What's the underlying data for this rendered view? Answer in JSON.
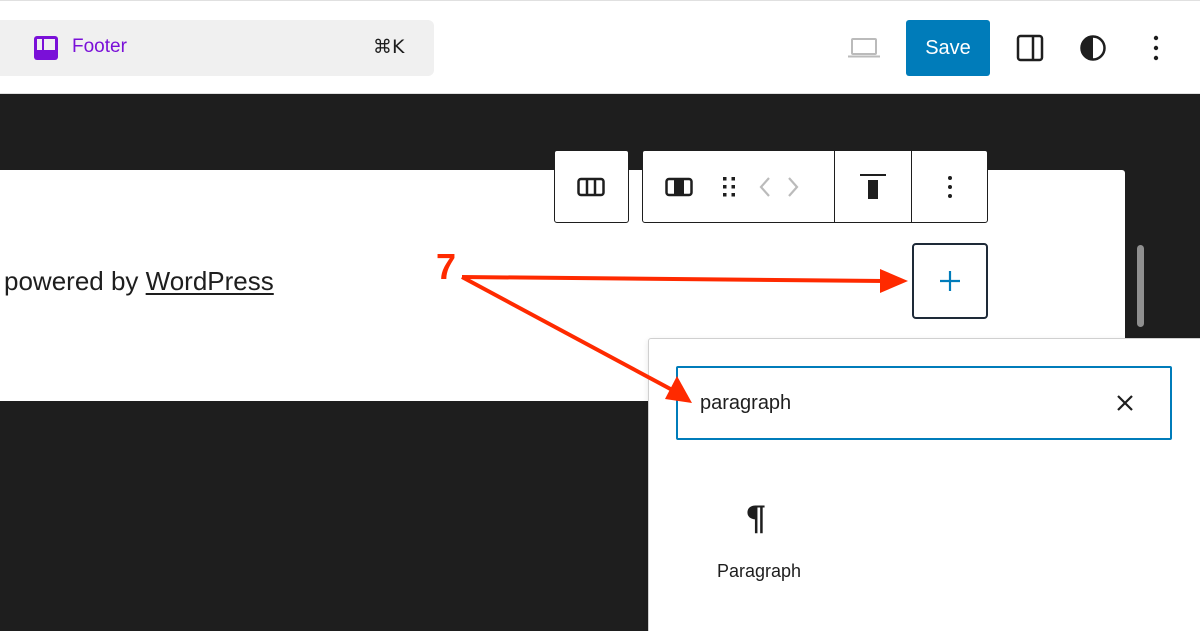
{
  "header": {
    "document_title": "Footer",
    "shortcut": "⌘K",
    "save_label": "Save",
    "icons": {
      "document": "template-part-icon",
      "preview": "laptop-icon",
      "settings": "sidebar-toggle-icon",
      "styles": "contrast-icon",
      "options": "more-vertical-icon"
    }
  },
  "canvas": {
    "footer_text_prefix": "powered by ",
    "footer_link": "WordPress"
  },
  "block_toolbar": {
    "icons": [
      "columns-parent-icon",
      "column-icon",
      "drag-handle-icon",
      "move-left-icon",
      "move-right-icon",
      "align-top-icon",
      "more-vertical-icon"
    ]
  },
  "inserter": {
    "button_symbol": "+"
  },
  "popover": {
    "search_value": "paragraph",
    "search_placeholder": "Search",
    "results": [
      {
        "label": "Paragraph",
        "icon": "¶"
      }
    ]
  },
  "annotation": {
    "step_number": "7",
    "color": "#ff2a00"
  },
  "colors": {
    "accent": "#007cba",
    "template_purple": "#7a10d8",
    "canvas_bg": "#1e1e1e"
  }
}
